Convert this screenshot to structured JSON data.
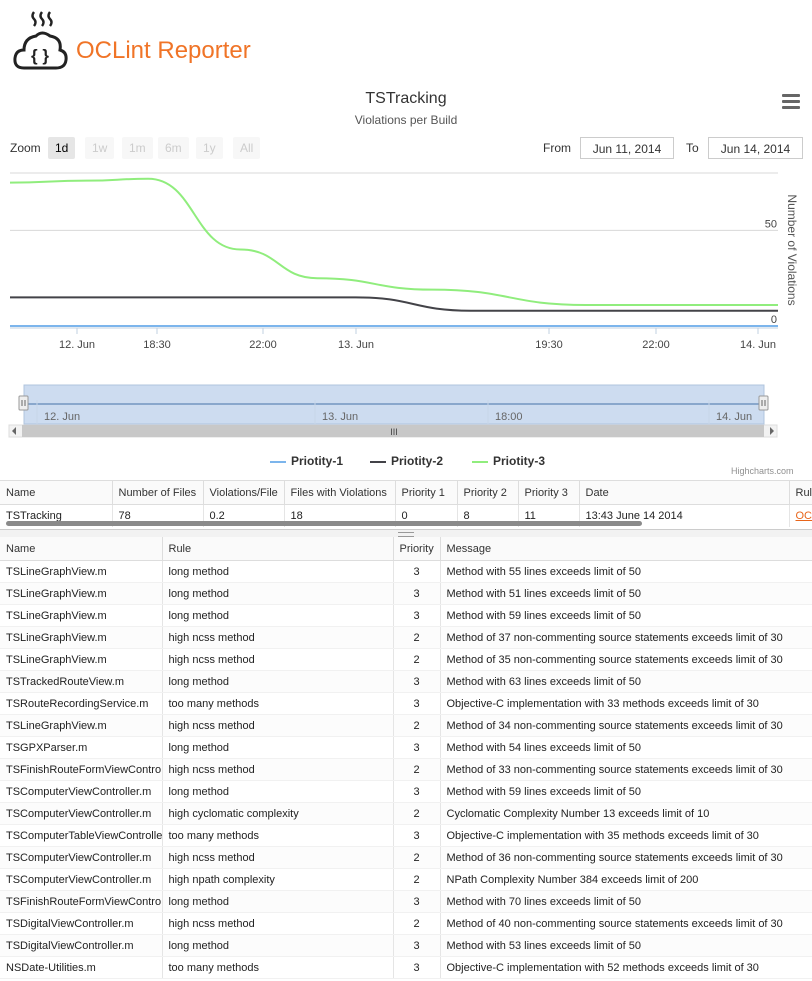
{
  "app": {
    "brand": "OCLint Reporter"
  },
  "chart": {
    "title": "TSTracking",
    "subtitle": "Violations per Build",
    "zoom_label": "Zoom",
    "zoom_buttons": [
      "1d",
      "1w",
      "1m",
      "6m",
      "1y",
      "All"
    ],
    "zoom_active": "1d",
    "from_label": "From",
    "from_value": "Jun 11, 2014",
    "to_label": "To",
    "to_value": "Jun 14, 2014",
    "y_axis_title": "Number of Violations",
    "y_tick_labels": [
      "50",
      "0"
    ],
    "x_tick_labels": [
      "12. Jun",
      "18:30",
      "22:00",
      "13. Jun",
      "19:30",
      "22:00",
      "14. Jun"
    ],
    "navigator_labels": [
      "12. Jun",
      "13. Jun",
      "18:00",
      "14. Jun"
    ],
    "navigator_grip": "III",
    "credits": "Highcharts.com",
    "colors": {
      "priority1": "#7cb5ec",
      "priority2": "#434348",
      "priority3": "#90ed7d"
    }
  },
  "chart_data": {
    "type": "line",
    "ylabel": "Number of Violations",
    "ylim": [
      0,
      80
    ],
    "x_range": [
      "Jun 11, 2014",
      "Jun 14, 2014"
    ],
    "legend_position": "bottom",
    "series": [
      {
        "name": "Priotity-1",
        "points": [
          [
            0,
            0
          ],
          [
            0.45,
            0
          ],
          [
            1,
            0
          ]
        ]
      },
      {
        "name": "Priotity-2",
        "points": [
          [
            0,
            15
          ],
          [
            0.45,
            15
          ],
          [
            0.6,
            8
          ],
          [
            1,
            8
          ]
        ]
      },
      {
        "name": "Priotity-3",
        "points": [
          [
            0,
            75
          ],
          [
            0.1,
            76
          ],
          [
            0.18,
            77
          ],
          [
            0.3,
            40
          ],
          [
            0.4,
            25
          ],
          [
            0.55,
            19
          ],
          [
            0.75,
            11
          ],
          [
            1,
            11
          ]
        ]
      }
    ]
  },
  "summary": {
    "headers": [
      "Name",
      "Number of Files",
      "Violations/File",
      "Files with Violations",
      "Priority 1",
      "Priority 2",
      "Priority 3",
      "Date",
      "Rul"
    ],
    "row": [
      "TSTracking",
      "78",
      "0.2",
      "18",
      "0",
      "8",
      "11",
      "13:43 June 14 2014",
      "OC"
    ]
  },
  "detail": {
    "headers": [
      "Name",
      "Rule",
      "Priority",
      "Message"
    ],
    "rows": [
      [
        "TSLineGraphView.m",
        "long method",
        "3",
        "Method with 55 lines exceeds limit of 50"
      ],
      [
        "TSLineGraphView.m",
        "long method",
        "3",
        "Method with 51 lines exceeds limit of 50"
      ],
      [
        "TSLineGraphView.m",
        "long method",
        "3",
        "Method with 59 lines exceeds limit of 50"
      ],
      [
        "TSLineGraphView.m",
        "high ncss method",
        "2",
        "Method of 37 non-commenting source statements exceeds limit of 30"
      ],
      [
        "TSLineGraphView.m",
        "high ncss method",
        "2",
        "Method of 35 non-commenting source statements exceeds limit of 30"
      ],
      [
        "TSTrackedRouteView.m",
        "long method",
        "3",
        "Method with 63 lines exceeds limit of 50"
      ],
      [
        "TSRouteRecordingService.m",
        "too many methods",
        "3",
        "Objective-C implementation with 33 methods exceeds limit of 30"
      ],
      [
        "TSLineGraphView.m",
        "high ncss method",
        "2",
        "Method of 34 non-commenting source statements exceeds limit of 30"
      ],
      [
        "TSGPXParser.m",
        "long method",
        "3",
        "Method with 54 lines exceeds limit of 50"
      ],
      [
        "TSFinishRouteFormViewContro",
        "high ncss method",
        "2",
        "Method of 33 non-commenting source statements exceeds limit of 30"
      ],
      [
        "TSComputerViewController.m",
        "long method",
        "3",
        "Method with 59 lines exceeds limit of 50"
      ],
      [
        "TSComputerViewController.m",
        "high cyclomatic complexity",
        "2",
        "Cyclomatic Complexity Number 13 exceeds limit of 10"
      ],
      [
        "TSComputerTableViewControlle",
        "too many methods",
        "3",
        "Objective-C implementation with 35 methods exceeds limit of 30"
      ],
      [
        "TSComputerViewController.m",
        "high ncss method",
        "2",
        "Method of 36 non-commenting source statements exceeds limit of 30"
      ],
      [
        "TSComputerViewController.m",
        "high npath complexity",
        "2",
        "NPath Complexity Number 384 exceeds limit of 200"
      ],
      [
        "TSFinishRouteFormViewContro",
        "long method",
        "3",
        "Method with 70 lines exceeds limit of 50"
      ],
      [
        "TSDigitalViewController.m",
        "high ncss method",
        "2",
        "Method of 40 non-commenting source statements exceeds limit of 30"
      ],
      [
        "TSDigitalViewController.m",
        "long method",
        "3",
        "Method with 53 lines exceeds limit of 50"
      ],
      [
        "NSDate-Utilities.m",
        "too many methods",
        "3",
        "Objective-C implementation with 52 methods exceeds limit of 30"
      ]
    ]
  }
}
